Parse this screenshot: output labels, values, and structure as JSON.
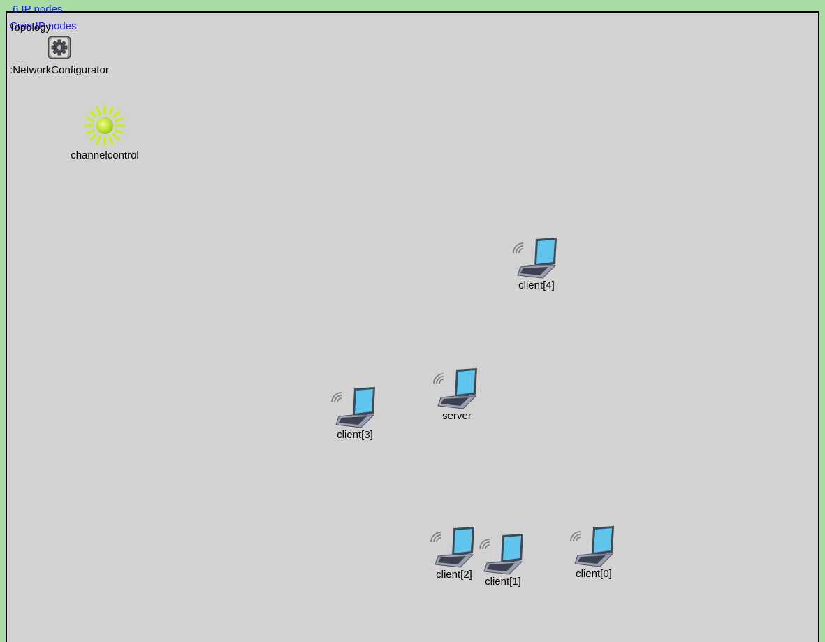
{
  "canvas": {
    "status_lines": [
      "6 IP nodes",
      "Crea IP nodes"
    ],
    "title": "Topology"
  },
  "modules": {
    "configurator_label": ":NetworkConfigurator",
    "channelcontrol_label": "channelcontrol"
  },
  "nodes": {
    "client4": "client[4]",
    "server": "server",
    "client3": "client[3]",
    "client2": "client[2]",
    "client1": "client[1]",
    "client0": "client[0]"
  },
  "colors": {
    "background_frame": "#a8dca4",
    "canvas": "#d2d2d2",
    "status_text": "#1a1aff",
    "sun": "#b8f000"
  },
  "icons": {
    "configurator": "gear-icon",
    "channelcontrol": "sun-icon",
    "host": "wireless-laptop-icon"
  }
}
